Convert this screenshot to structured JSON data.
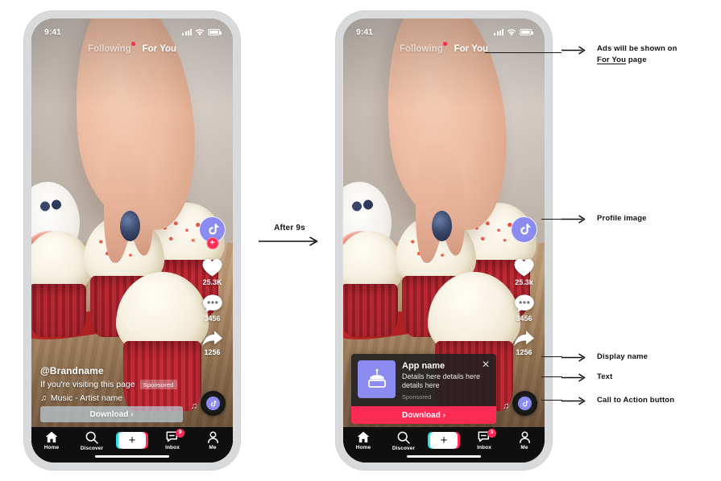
{
  "statusbar": {
    "time": "9:41",
    "signal_icon": "signal-bars-icon",
    "wifi_icon": "wifi-icon",
    "battery_icon": "battery-icon"
  },
  "top_tabs": {
    "following": "Following",
    "for_you": "For You"
  },
  "phone1": {
    "rail": {
      "avatar_icon": "tiktok-note-icon",
      "follow_plus": "+",
      "like_icon": "heart-icon",
      "like_count": "25.3K",
      "comment_icon": "comment-dots-icon",
      "comment_count": "3456",
      "share_icon": "share-arrow-icon",
      "share_count": "1256"
    },
    "caption": {
      "handle": "@Brandname",
      "description": "If you're visiting this page",
      "sponsored": "Sponsored",
      "music_icon": "music-note-icon",
      "music": "Music - Artist name"
    },
    "cta": {
      "label": "Download",
      "chevron": "›"
    }
  },
  "phone2": {
    "rail": {
      "avatar_icon": "tiktok-note-icon",
      "like_icon": "heart-icon",
      "like_count": "25.3k",
      "comment_icon": "comment-dots-icon",
      "comment_count": "3456",
      "share_icon": "share-arrow-icon",
      "share_count": "1256"
    },
    "ad_card": {
      "app_icon": "cake-icon",
      "title": "App name",
      "description": "Details here details here details here",
      "sponsored": "Sponsored",
      "close_icon": "close-x-icon",
      "cta_label": "Download",
      "cta_chevron": "›"
    }
  },
  "navbar": {
    "items": [
      {
        "icon": "home-icon",
        "label": "Home"
      },
      {
        "icon": "search-icon",
        "label": "Discover"
      },
      {
        "icon": "plus-icon",
        "label": ""
      },
      {
        "icon": "inbox-message-icon",
        "label": "Inbox",
        "badge": "9"
      },
      {
        "icon": "person-icon",
        "label": "Me"
      }
    ]
  },
  "middle": {
    "label": "After 9s",
    "arrow_icon": "long-right-arrow-icon"
  },
  "annotations": [
    {
      "arrow_icon": "right-arrow-icon",
      "line1_pre": "Ads will be shown on",
      "line2_underline": "For You",
      "line2_post": " page"
    },
    {
      "arrow_icon": "right-arrow-icon",
      "text": "Profile image"
    },
    {
      "arrow_icon": "right-arrow-icon",
      "text": "Display name"
    },
    {
      "arrow_icon": "right-arrow-icon",
      "text": "Text"
    },
    {
      "arrow_icon": "right-arrow-icon",
      "text": "Call to Action button"
    }
  ],
  "colors": {
    "accent_pink": "#FE2C55",
    "avatar_purple": "#8B8BF0",
    "nav_dark": "#0F0F0F",
    "frame_gray": "#D8DADB"
  }
}
